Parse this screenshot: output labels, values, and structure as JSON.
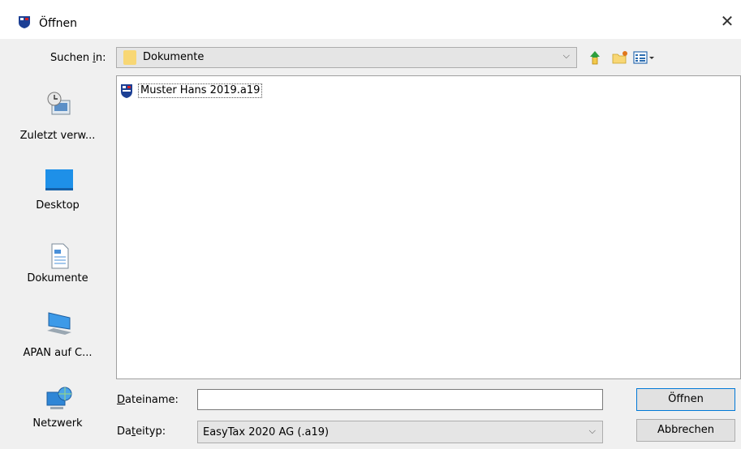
{
  "window": {
    "title": "Öffnen",
    "close_glyph": "✕"
  },
  "lookin": {
    "label_prefix": "Suchen ",
    "label_accel": "i",
    "label_suffix": "n:",
    "value": "Dokumente",
    "folder_icon": "folder-icon"
  },
  "toolbar": {
    "up_icon": "up-folder-icon",
    "new_folder_icon": "new-folder-icon",
    "view_icon": "view-menu-icon"
  },
  "places": [
    {
      "label": "Zuletzt verw...",
      "icon": "recent-icon"
    },
    {
      "label": "Desktop",
      "icon": "desktop-icon"
    },
    {
      "label": "Dokumente",
      "icon": "documents-icon"
    },
    {
      "label": "APAN auf C...",
      "icon": "computer-icon"
    },
    {
      "label": "Netzwerk",
      "icon": "network-icon"
    }
  ],
  "files": [
    {
      "name": "Muster Hans 2019.a19",
      "icon": "easytax-file-icon"
    }
  ],
  "filename": {
    "label_accel": "D",
    "label_rest": "ateiname:",
    "value": ""
  },
  "filetype": {
    "label_first": "Da",
    "label_accel": "t",
    "label_rest": "eityp:",
    "value": "EasyTax 2020 AG (.a19)"
  },
  "buttons": {
    "open": "Öffnen",
    "cancel": "Abbrechen"
  },
  "chevron": "⌵"
}
